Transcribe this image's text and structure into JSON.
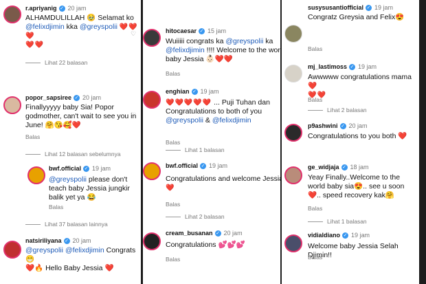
{
  "col1": {
    "c1": {
      "user": "r.apriyanig",
      "time": "20 jam",
      "text_a": "ALHAMDULILLAH 🥹 Selamat ko",
      "mention1": "@felixdjimin",
      "text_b": " kka ",
      "mention2": "@greyspolii",
      "hearts": "❤️❤️❤️",
      "reply": "Balas"
    },
    "more1": "Lihat 22 balasan",
    "c2": {
      "user": "popor_sapsiree",
      "time": "20 jam",
      "text": "Finallyyyyy baby Sia! Popor godmother, can't wait to see you in June! 🤗😘🥰❤️",
      "reply": "Balas"
    },
    "more2": "Lihat 12 balasan sebelumnya",
    "c3": {
      "user": "bwf.official",
      "time": "19 jam",
      "mention": "@greyspolii",
      "text": " please don't teach baby Jessia jungkir balik yet ya 😂",
      "reply": "Balas"
    },
    "more3": "Lihat 37 balasan lainnya",
    "c4": {
      "user": "natsiriliyana",
      "time": "20 jam",
      "mention1": "@greyspolii",
      "mention2": "@felixdjimin",
      "text_a": " Congrats 😁",
      "text_b": "❤️🔥 Hello Baby Jessia ❤️"
    }
  },
  "col2": {
    "c1": {
      "user": "hitocaesar",
      "time": "15 jam",
      "text_a": "Wuiiiii congrats ka ",
      "mention1": "@greyspolii",
      "text_b": " ka ",
      "mention2": "@felixdjimin",
      "text_c": " !!!! Welcome to the wor",
      "text_d": "baby Jessia 👶🏻❤️❤️",
      "reply": "Balas"
    },
    "c2": {
      "user": "enghian",
      "time": "19 jam",
      "hearts": "❤️❤️❤️❤️❤️",
      "text_a": " ... Puji Tuhan dan Congratulations to both of you",
      "mention1": "@greyspolii",
      "text_b": " & ",
      "mention2": "@felixdjimin",
      "reply": "Balas"
    },
    "more1": "Lihat 1 balasan",
    "c3": {
      "user": "bwf.official",
      "time": "19 jam",
      "text": "Congratulations and welcome Jessia",
      "hearts": "❤️",
      "reply": "Balas"
    },
    "more2": "Lihat 2 balasan",
    "c4": {
      "user": "cream_busanan",
      "time": "20 jam",
      "text": "Congratulations 💕💕💕",
      "reply": "Balas"
    }
  },
  "col3": {
    "c1": {
      "user": "susysusantiofficial",
      "time": "19 jam",
      "text": "Congratz Greysia and Felix😍",
      "reply": "Balas"
    },
    "c2": {
      "user": "mj_lastimoss",
      "time": "19 jam",
      "text": "Awwwww congratulations mama ❤️",
      "hearts": "❤️❤️",
      "reply": "Balas"
    },
    "more1": "Lihat 2 balasan",
    "c3": {
      "user": "p9ashwini",
      "time": "20 jam",
      "text": "Congratulations to you both ❤️",
      "reply": "Balas"
    },
    "c4": {
      "user": "ge_widjaja",
      "time": "18 jam",
      "text": "Yeay Finally..Welcome to the world baby sia😍.. see u soon❤️.. speed recovery kak🤗",
      "reply": "Balas"
    },
    "more2": "Lihat 1 balasan",
    "c5": {
      "user": "vidialdiano",
      "time": "19 jam",
      "text": "Welcome baby Jessia Selah Djimin!!",
      "reply": "Balas"
    }
  },
  "colors": {
    "mention": "#1e5bb8",
    "badge": "#3897f0",
    "heart": "#d41b2c"
  }
}
